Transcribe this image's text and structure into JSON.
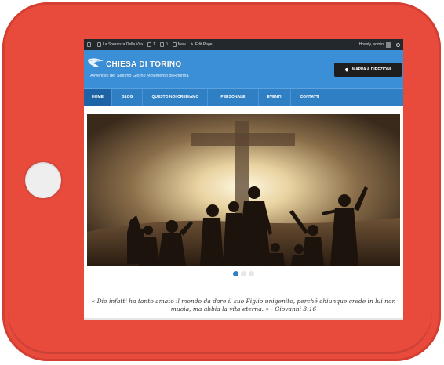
{
  "adminbar": {
    "site_name": "La Speranza Della Vita",
    "updates_count": "1",
    "comments_count": "0",
    "new_label": "New",
    "edit_label": "Edit Page",
    "howdy": "Howdy, admin"
  },
  "header": {
    "title": "CHIESA DI TORINO",
    "tagline": "Avventisti del Settimo Giorno Movimento di Riforma",
    "map_button": "MAPPA & DIREZIONI"
  },
  "nav": {
    "items": [
      {
        "label": "HOME"
      },
      {
        "label": "BLOG"
      },
      {
        "label": "QUESTO NOI CREDIAMO"
      },
      {
        "label": "PERSONALE"
      },
      {
        "label": "EVENTI"
      },
      {
        "label": "CONTATTI"
      }
    ]
  },
  "slider": {
    "active_dot": 1,
    "dot_count": 3
  },
  "verse": {
    "text": "« Dio infatti ha tanto amato il mondo da dare il suo Figlio unigenito, perché chiunque crede in lui non muoia, ma abbia la vita eterna. » - Giovanni 3:16"
  },
  "colors": {
    "frame": "#e84a3c",
    "header": "#3b8fd6",
    "nav": "#2f7fc4",
    "nav_active": "#1d63a6",
    "adminbar": "#23282d"
  }
}
